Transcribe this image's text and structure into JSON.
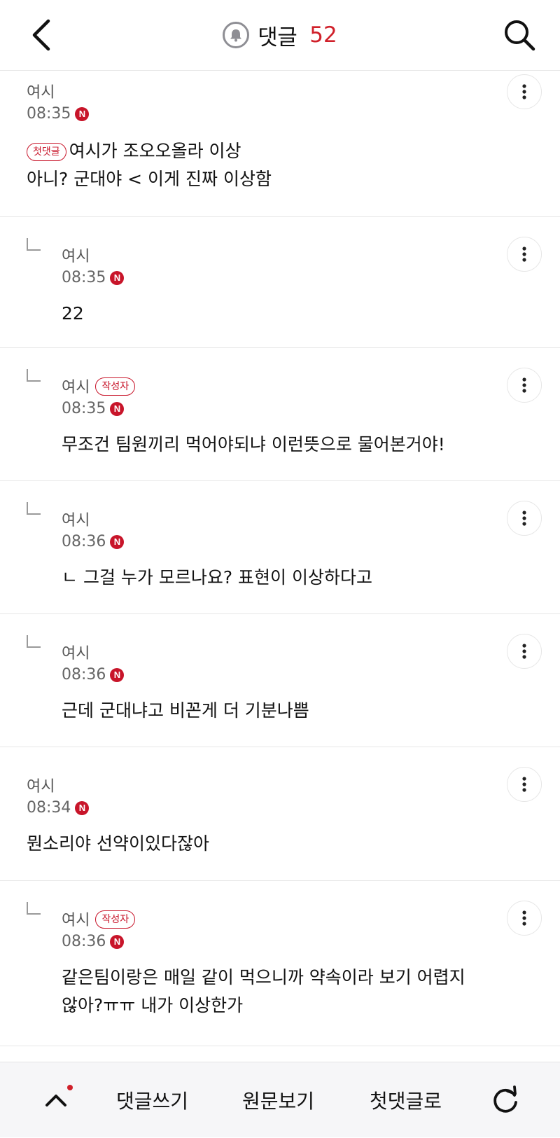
{
  "header": {
    "back_icon": "chevron-left-icon",
    "bell_icon": "bell-icon",
    "title": "댓글",
    "count": "52",
    "search_icon": "search-icon"
  },
  "comments": [
    {
      "author": "여시",
      "time": "08:35",
      "new_badge": "N",
      "first_comment_label": "첫댓글",
      "line1": "여시가 조오오올라 이상",
      "line2": "아니? 군대야 < 이게 진짜 이상함"
    },
    {
      "author": "여시",
      "time": "08:35",
      "new_badge": "N",
      "text": "22"
    },
    {
      "author": "여시",
      "author_badge": "작성자",
      "time": "08:35",
      "new_badge": "N",
      "text": "무조건 팀원끼리 먹어야되냐 이런뜻으로 물어본거야!"
    },
    {
      "author": "여시",
      "time": "08:36",
      "new_badge": "N",
      "text": "ㄴ 그걸 누가 모르나요? 표현이 이상하다고"
    },
    {
      "author": "여시",
      "time": "08:36",
      "new_badge": "N",
      "text": "근데 군대냐고 비꼰게 더 기분나쁨"
    },
    {
      "author": "여시",
      "time": "08:34",
      "new_badge": "N",
      "text": "뭔소리야 선약이있다잖아"
    },
    {
      "author": "여시",
      "author_badge": "작성자",
      "time": "08:36",
      "new_badge": "N",
      "line1": "같은팀이랑은 매일 같이 먹으니까 약속이라 보기 어렵지",
      "line2": "않아?ㅠㅠ 내가 이상한가"
    }
  ],
  "bottom_bar": {
    "up_icon": "chevron-up-icon",
    "write_label": "댓글쓰기",
    "original_label": "원문보기",
    "first_label": "첫댓글로",
    "refresh_icon": "refresh-icon"
  },
  "colors": {
    "accent": "#d0202a",
    "badge": "#c8152a",
    "divider": "#e8e8e8",
    "bottom_bg": "#f6f6f8"
  }
}
